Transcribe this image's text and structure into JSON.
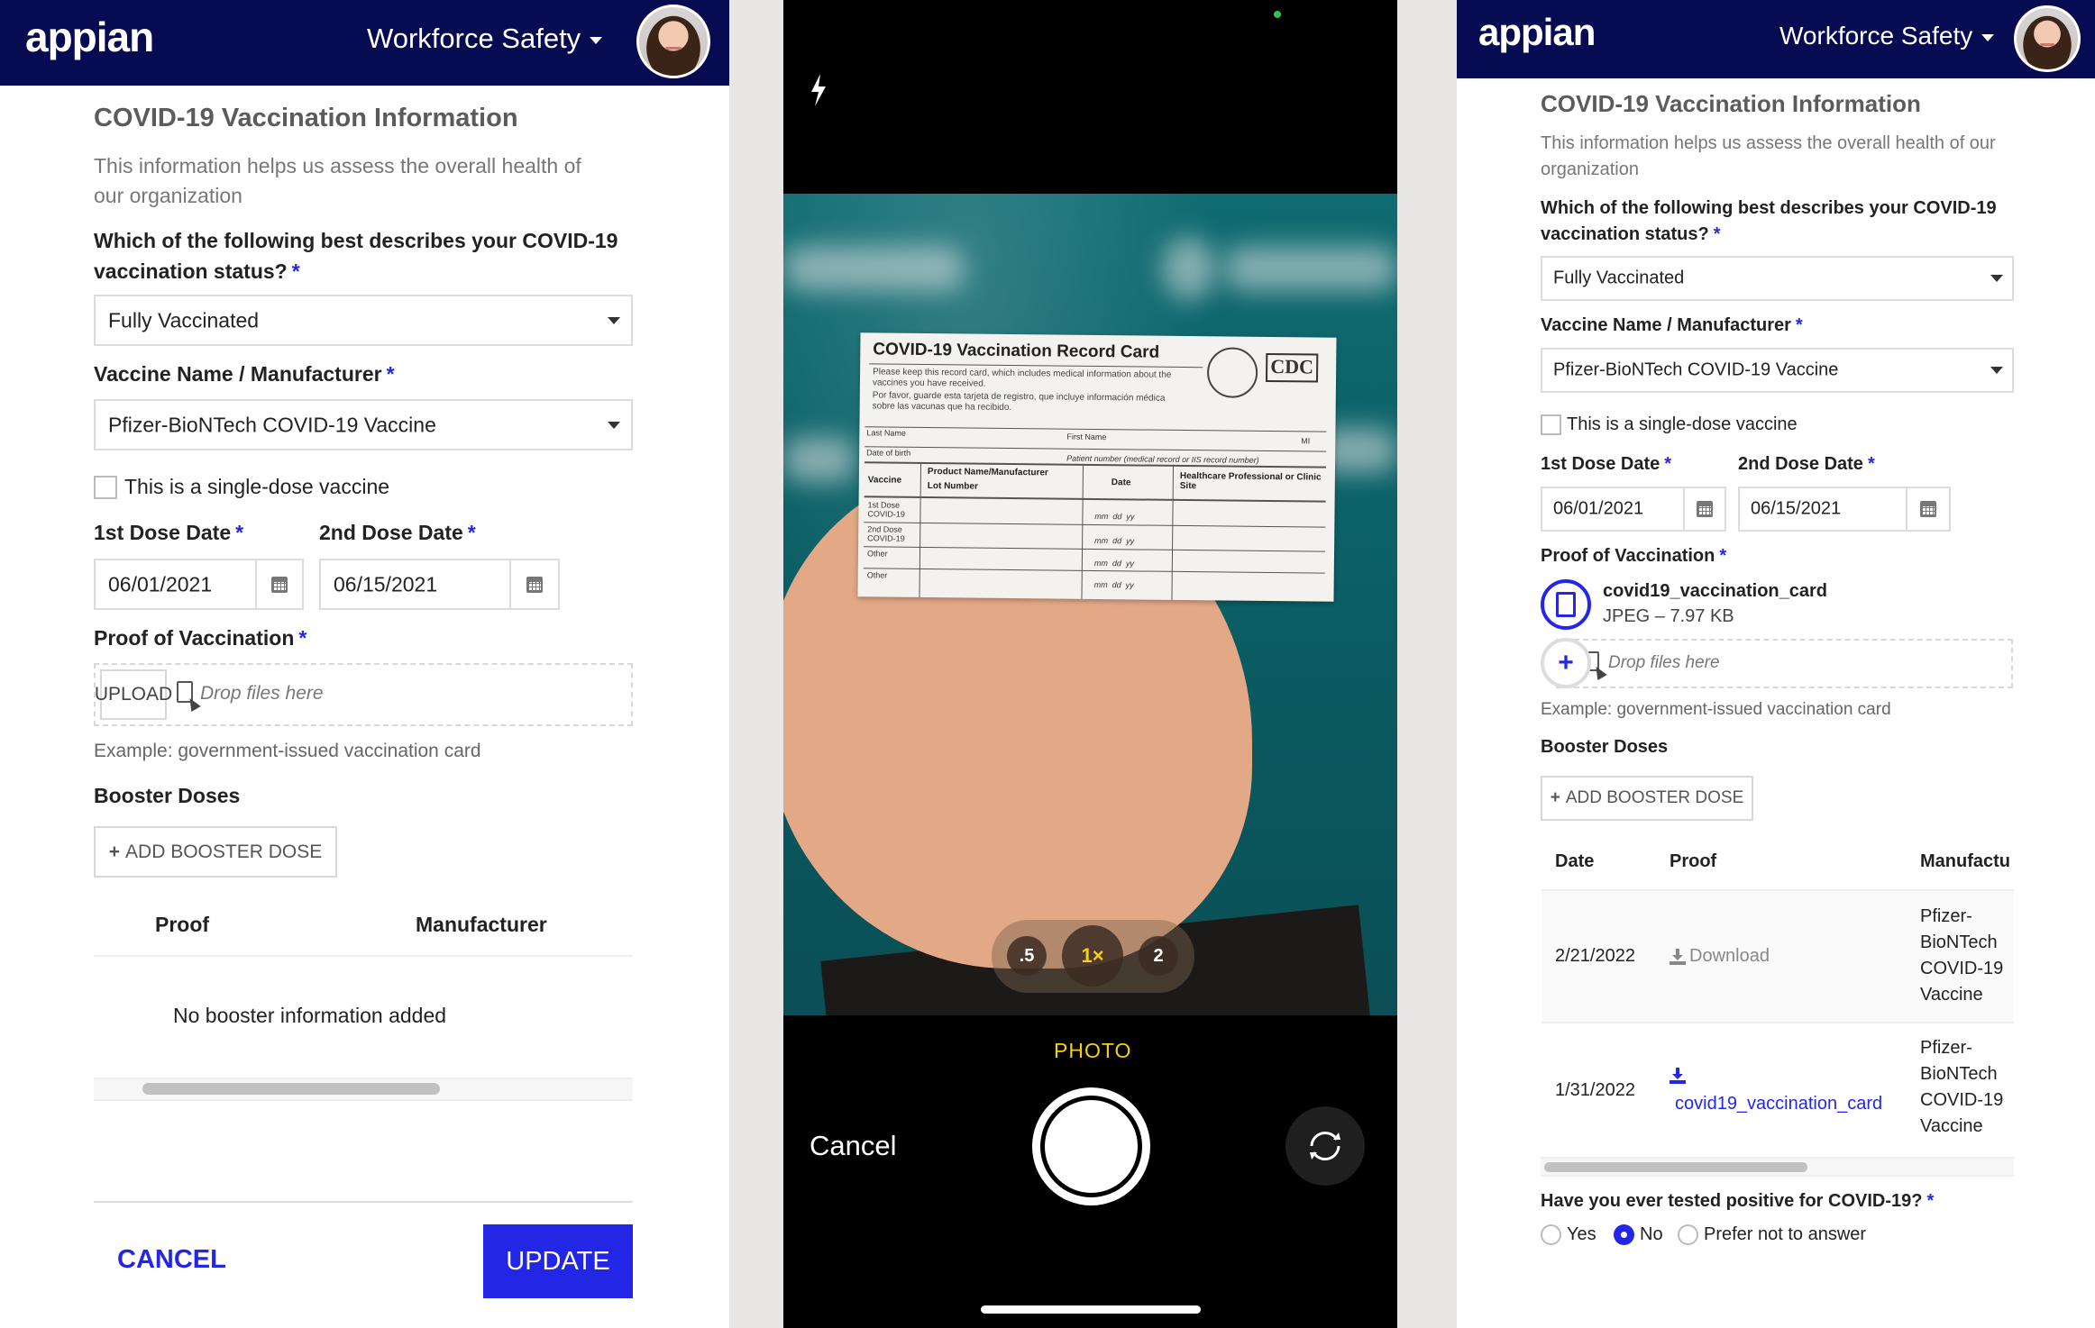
{
  "left_form": {
    "header": {
      "logo": "appian",
      "app_name": "Workforce Safety"
    },
    "title": "COVID-19 Vaccination Information",
    "subtitle": "This information helps us assess the overall health of our organization",
    "status_question": "Which of the following best describes your COVID-19 vaccination status?",
    "status_value": "Fully Vaccinated",
    "vaccine_label": "Vaccine Name / Manufacturer",
    "vaccine_value": "Pfizer-BioNTech COVID-19 Vaccine",
    "single_dose_label": "This is a single-dose vaccine",
    "single_dose_checked": false,
    "dose1_label": "1st Dose Date",
    "dose1_value": "06/01/2021",
    "dose2_label": "2nd Dose Date",
    "dose2_value": "06/15/2021",
    "proof_label": "Proof of Vaccination",
    "upload_label": "UPLOAD",
    "drop_text": "Drop files here",
    "proof_help": "Example: government-issued vaccination card",
    "booster_label": "Booster Doses",
    "add_booster_label": "ADD BOOSTER DOSE",
    "table_headers": [
      "Proof",
      "Manufacturer"
    ],
    "empty_text": "No booster information added",
    "cancel_label": "CANCEL",
    "update_label": "UPDATE",
    "required_mark": "*"
  },
  "camera": {
    "zoom_options": [
      ".5",
      "1×",
      "2"
    ],
    "zoom_selected": "1×",
    "mode": "PHOTO",
    "cancel_label": "Cancel",
    "card": {
      "title": "COVID-19 Vaccination Record Card",
      "text_en": "Please keep this record card, which includes medical information about the vaccines you have received.",
      "text_es": "Por favor, guarde esta tarjeta de registro, que incluye información médica sobre las vacunas que ha recibido.",
      "cdc": "CDC",
      "last_name": "Last Name",
      "first_name": "First Name",
      "mi": "MI",
      "dob": "Date of birth",
      "patient_number": "Patient number (medical record or IIS record number)",
      "col_vaccine": "Vaccine",
      "col_product": "Product Name/Manufacturer",
      "col_lot": "Lot Number",
      "col_date": "Date",
      "col_site": "Healthcare Professional or Clinic Site",
      "rows": [
        "1st Dose COVID-19",
        "2nd Dose COVID-19",
        "Other",
        "Other"
      ],
      "date_fmt": "mm  dd  yy"
    }
  },
  "right_form": {
    "header": {
      "logo": "appian",
      "app_name": "Workforce Safety"
    },
    "title": "COVID-19 Vaccination Information",
    "subtitle": "This information helps us assess the overall health of our organization",
    "status_question": "Which of the following best describes your COVID-19 vaccination status?",
    "status_value": "Fully Vaccinated",
    "vaccine_label": "Vaccine Name / Manufacturer",
    "vaccine_value": "Pfizer-BioNTech COVID-19 Vaccine",
    "single_dose_label": "This is a single-dose vaccine",
    "single_dose_checked": false,
    "dose1_label": "1st Dose Date",
    "dose1_value": "06/01/2021",
    "dose2_label": "2nd Dose Date",
    "dose2_value": "06/15/2021",
    "proof_label": "Proof of Vaccination",
    "uploaded_file": {
      "name": "covid19_vaccination_card",
      "meta": "JPEG – 7.97 KB"
    },
    "drop_text": "Drop files here",
    "proof_help": "Example: government-issued vaccination card",
    "booster_label": "Booster Doses",
    "add_booster_label": "ADD BOOSTER DOSE",
    "table_headers": [
      "Date",
      "Proof",
      "Manufactu"
    ],
    "rows": [
      {
        "date": "2/21/2022",
        "proof": "Download",
        "manufacturer": [
          "Pfizer-",
          "BioNTech",
          "COVID-19",
          "Vaccine"
        ]
      },
      {
        "date": "1/31/2022",
        "proof": "covid19_vaccination_card",
        "manufacturer": [
          "Pfizer-",
          "BioNTech",
          "COVID-19",
          "Vaccine"
        ]
      }
    ],
    "positive_question": "Have you ever tested positive for COVID-19?",
    "positive_options": [
      "Yes",
      "No",
      "Prefer not to answer"
    ],
    "positive_selected": "No",
    "required_mark": "*"
  }
}
